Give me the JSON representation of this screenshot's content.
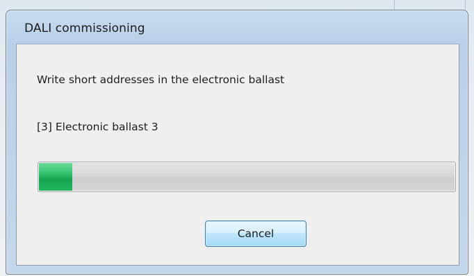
{
  "dialog": {
    "title": "DALI commissioning",
    "message": "Write short addresses in the electronic ballast",
    "device_status": "[3] Electronic ballast 3",
    "progress": {
      "fraction": 0.08,
      "color": "#16a552"
    },
    "cancel_label": "Cancel"
  }
}
